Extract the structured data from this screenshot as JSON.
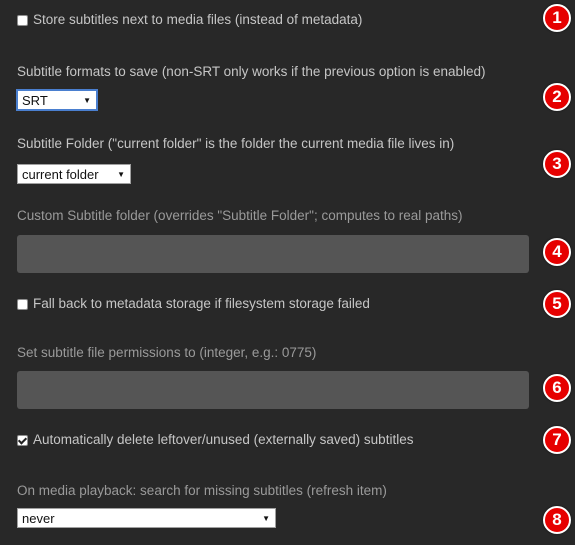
{
  "settings": {
    "store_next_to_media": {
      "label": "Store subtitles next to media files (instead of metadata)",
      "checked": false
    },
    "formats": {
      "label": "Subtitle formats to save (non-SRT only works if the previous option is enabled)",
      "selected": "SRT"
    },
    "folder": {
      "label": "Subtitle Folder (\"current folder\" is the folder the current media file lives in)",
      "selected": "current folder"
    },
    "custom_folder": {
      "label": "Custom Subtitle folder (overrides \"Subtitle Folder\"; computes to real paths)",
      "value": ""
    },
    "fallback_metadata": {
      "label": "Fall back to metadata storage if filesystem storage failed",
      "checked": false
    },
    "permissions": {
      "label": "Set subtitle file permissions to (integer, e.g.: 0775)",
      "value": ""
    },
    "auto_delete": {
      "label": "Automatically delete leftover/unused (externally saved) subtitles",
      "checked": true
    },
    "playback_search": {
      "label": "On media playback: search for missing subtitles (refresh item)",
      "selected": "never"
    }
  },
  "badges": [
    "1",
    "2",
    "3",
    "4",
    "5",
    "6",
    "7",
    "8"
  ],
  "colors": {
    "background": "#282828",
    "field": "#555555",
    "badge": "#e60000"
  }
}
